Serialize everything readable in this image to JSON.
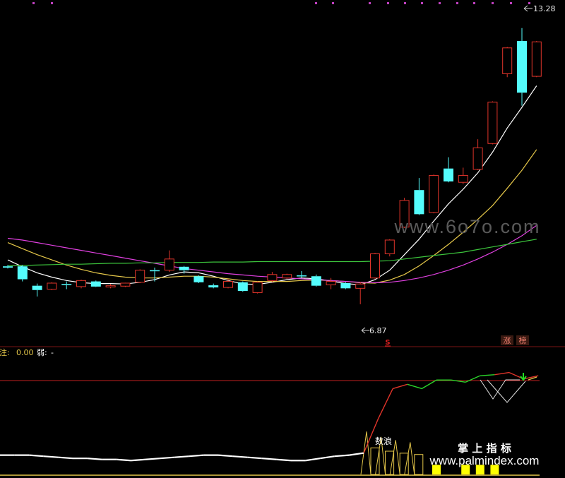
{
  "chart_data": [
    {
      "type": "candlestick",
      "panel": "main",
      "annotations": {
        "high_label": "13.28",
        "low_label": "6.87",
        "signal_marker": "S",
        "tags": [
          "涨",
          "榜"
        ]
      },
      "ylim": [
        6.0,
        13.8
      ],
      "candles": [
        {
          "o": 7.75,
          "c": 7.72,
          "h": 7.78,
          "l": 7.7
        },
        {
          "o": 7.75,
          "c": 7.45,
          "h": 7.78,
          "l": 7.4
        },
        {
          "o": 7.3,
          "c": 7.2,
          "h": 7.35,
          "l": 7.05
        },
        {
          "o": 7.22,
          "c": 7.36,
          "h": 7.38,
          "l": 7.2
        },
        {
          "o": 7.34,
          "c": 7.32,
          "h": 7.4,
          "l": 7.22
        },
        {
          "o": 7.28,
          "c": 7.42,
          "h": 7.44,
          "l": 7.24
        },
        {
          "o": 7.4,
          "c": 7.28,
          "h": 7.42,
          "l": 7.27
        },
        {
          "o": 7.27,
          "c": 7.3,
          "h": 7.34,
          "l": 7.24
        },
        {
          "o": 7.29,
          "c": 7.36,
          "h": 7.37,
          "l": 7.27
        },
        {
          "o": 7.38,
          "c": 7.66,
          "h": 7.68,
          "l": 7.36
        },
        {
          "o": 7.66,
          "c": 7.64,
          "h": 7.72,
          "l": 7.4
        },
        {
          "o": 7.66,
          "c": 7.92,
          "h": 8.12,
          "l": 7.62
        },
        {
          "o": 7.74,
          "c": 7.66,
          "h": 7.76,
          "l": 7.58
        },
        {
          "o": 7.52,
          "c": 7.38,
          "h": 7.54,
          "l": 7.36
        },
        {
          "o": 7.31,
          "c": 7.26,
          "h": 7.35,
          "l": 7.24
        },
        {
          "o": 7.26,
          "c": 7.4,
          "h": 7.46,
          "l": 7.24
        },
        {
          "o": 7.38,
          "c": 7.18,
          "h": 7.4,
          "l": 7.16
        },
        {
          "o": 7.14,
          "c": 7.38,
          "h": 7.4,
          "l": 7.12
        },
        {
          "o": 7.42,
          "c": 7.56,
          "h": 7.62,
          "l": 7.38
        },
        {
          "o": 7.48,
          "c": 7.56,
          "h": 7.58,
          "l": 7.46
        },
        {
          "o": 7.54,
          "c": 7.52,
          "h": 7.64,
          "l": 7.48
        },
        {
          "o": 7.52,
          "c": 7.3,
          "h": 7.56,
          "l": 7.28
        },
        {
          "o": 7.32,
          "c": 7.4,
          "h": 7.48,
          "l": 7.22
        },
        {
          "o": 7.36,
          "c": 7.24,
          "h": 7.38,
          "l": 7.22
        },
        {
          "o": 7.24,
          "c": 7.34,
          "h": 7.38,
          "l": 6.87
        },
        {
          "o": 7.48,
          "c": 8.04,
          "h": 8.06,
          "l": 7.46
        },
        {
          "o": 8.04,
          "c": 8.36,
          "h": 8.38,
          "l": 7.98
        },
        {
          "o": 8.66,
          "c": 9.28,
          "h": 9.34,
          "l": 8.64
        },
        {
          "o": 9.52,
          "c": 8.96,
          "h": 9.8,
          "l": 8.94
        },
        {
          "o": 9.0,
          "c": 9.86,
          "h": 9.88,
          "l": 8.98
        },
        {
          "o": 10.02,
          "c": 9.72,
          "h": 10.28,
          "l": 9.7
        },
        {
          "o": 9.7,
          "c": 9.86,
          "h": 10.04,
          "l": 9.66
        },
        {
          "o": 10.0,
          "c": 10.5,
          "h": 10.7,
          "l": 9.98
        },
        {
          "o": 10.6,
          "c": 11.56,
          "h": 11.58,
          "l": 10.58
        },
        {
          "o": 12.22,
          "c": 12.82,
          "h": 12.84,
          "l": 12.14
        },
        {
          "o": 12.98,
          "c": 11.78,
          "h": 13.28,
          "l": 11.48
        },
        {
          "o": 12.16,
          "c": 12.96,
          "h": 12.98,
          "l": 12.14
        }
      ],
      "moving_averages": [
        {
          "color": "#ffffff",
          "values": [
            7.9,
            7.74,
            7.6,
            7.5,
            7.42,
            7.37,
            7.35,
            7.35,
            7.34,
            7.38,
            7.44,
            7.55,
            7.62,
            7.6,
            7.52,
            7.42,
            7.34,
            7.33,
            7.38,
            7.44,
            7.48,
            7.46,
            7.41,
            7.35,
            7.32,
            7.44,
            7.66,
            8.02,
            8.38,
            8.8,
            9.2,
            9.54,
            9.92,
            10.4,
            10.96,
            11.44,
            11.94
          ]
        },
        {
          "color": "#e6c84a",
          "values": [
            8.3,
            8.16,
            8.02,
            7.9,
            7.78,
            7.68,
            7.6,
            7.54,
            7.5,
            7.48,
            7.48,
            7.5,
            7.52,
            7.52,
            7.5,
            7.46,
            7.42,
            7.4,
            7.4,
            7.4,
            7.42,
            7.43,
            7.42,
            7.4,
            7.37,
            7.36,
            7.43,
            7.56,
            7.76,
            8.0,
            8.26,
            8.54,
            8.84,
            9.16,
            9.56,
            9.98,
            10.46
          ]
        },
        {
          "color": "#e040e0",
          "values": [
            8.4,
            8.36,
            8.3,
            8.24,
            8.18,
            8.12,
            8.06,
            8.0,
            7.94,
            7.88,
            7.82,
            7.76,
            7.7,
            7.66,
            7.62,
            7.58,
            7.55,
            7.52,
            7.5,
            7.48,
            7.46,
            7.44,
            7.42,
            7.4,
            7.38,
            7.37,
            7.38,
            7.42,
            7.48,
            7.56,
            7.66,
            7.78,
            7.92,
            8.08,
            8.26,
            8.46,
            8.7
          ]
        },
        {
          "color": "#3cc43c",
          "values": [
            7.76,
            7.77,
            7.78,
            7.79,
            7.8,
            7.8,
            7.81,
            7.82,
            7.82,
            7.83,
            7.83,
            7.84,
            7.84,
            7.84,
            7.85,
            7.85,
            7.85,
            7.86,
            7.86,
            7.86,
            7.86,
            7.86,
            7.86,
            7.86,
            7.86,
            7.87,
            7.88,
            7.92,
            7.96,
            8.0,
            8.04,
            8.08,
            8.14,
            8.2,
            8.26,
            8.32,
            8.38
          ]
        }
      ]
    },
    {
      "type": "line",
      "panel": "indicator",
      "header": [
        {
          "text": "关注:",
          "color": "#e6c84a"
        },
        {
          "text": "0.00",
          "color": "#e6c84a"
        },
        {
          "text": "弱:",
          "color": "#ffffff"
        },
        {
          "text": "-",
          "color": "#ffffff"
        }
      ],
      "labels": [
        "数浪",
        "掌 上 指 标",
        "www.palmindex.com"
      ],
      "ylim": [
        0,
        100
      ],
      "threshold": 90,
      "trend_line": [
        18,
        18,
        18,
        17,
        16,
        15,
        15,
        14,
        14,
        13,
        14,
        15,
        16,
        17,
        18,
        18,
        17,
        16,
        15,
        14,
        13,
        13,
        15,
        17,
        18,
        20,
        52,
        80,
        84,
        80,
        88,
        88,
        86,
        92,
        93,
        95,
        89,
        92
      ],
      "bars": [
        0,
        0,
        0,
        0,
        0,
        0,
        0,
        0,
        0,
        0,
        0,
        0,
        0,
        0,
        0,
        0,
        0,
        0,
        0,
        0,
        0,
        0,
        0,
        0,
        0,
        40,
        35,
        32,
        30,
        0,
        9,
        0,
        9,
        9,
        9,
        0,
        0,
        0
      ],
      "bar_color_outline": "#e6c84a",
      "bar_color_fill": "#ffff00"
    }
  ],
  "watermarks": [
    "www.6o7o.com"
  ]
}
